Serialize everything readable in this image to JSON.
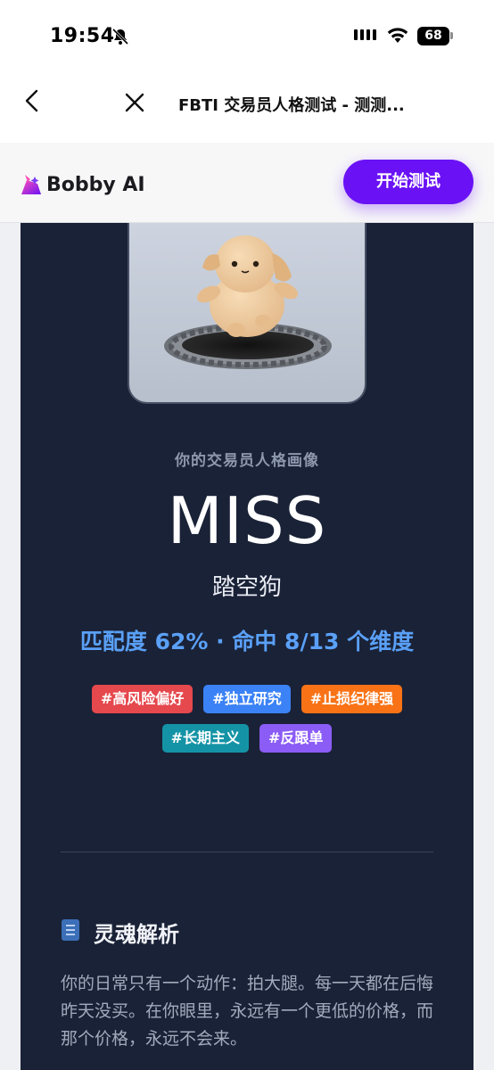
{
  "status": {
    "time": "19:54",
    "battery": "68"
  },
  "nav": {
    "title": "FBTI 交易员人格测试 - 测测..."
  },
  "header": {
    "brand": "Bobby AI",
    "start_button": "开始测试"
  },
  "result": {
    "subtitle": "你的交易员人格画像",
    "type_code": "MISS",
    "type_name": "踏空狗",
    "match": "匹配度 62% · 命中 8/13 个维度",
    "match_percent": 62,
    "tags": [
      {
        "label": "#高风险偏好",
        "color": "#e5484d"
      },
      {
        "label": "#独立研究",
        "color": "#3b82f6"
      },
      {
        "label": "#止损纪律强",
        "color": "#f97316"
      },
      {
        "label": "#长期主义",
        "color": "#1593a6"
      },
      {
        "label": "#反跟单",
        "color": "#8b5cf6"
      }
    ]
  },
  "section": {
    "icon": "document-icon",
    "title": "灵魂解析",
    "body": "你的日常只有一个动作：拍大腿。每一天都在后悔昨天没买。在你眼里，永远有一个更低的价格，而那个价格，永远不会来。"
  }
}
